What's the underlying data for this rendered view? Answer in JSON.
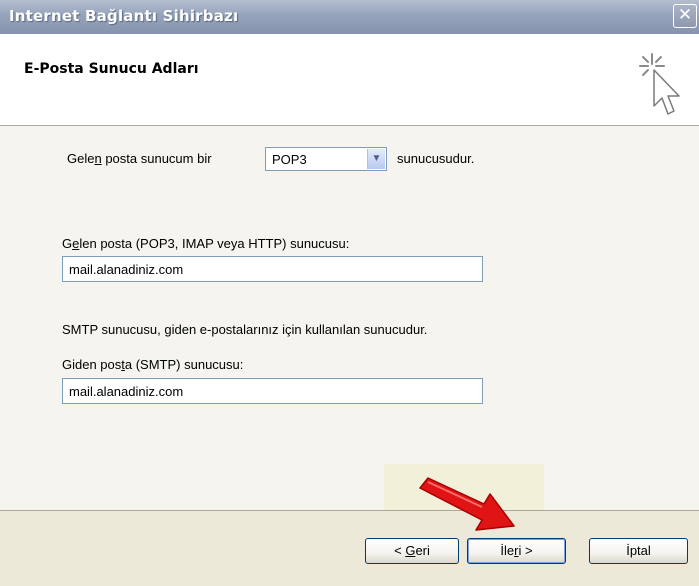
{
  "window": {
    "title": "Internet Bağlantı Sihirbazı",
    "close_label": "✕"
  },
  "header": {
    "title": "E-Posta Sunucu Adları"
  },
  "incoming_type": {
    "label_prefix": "Gele",
    "label_underlined": "n",
    "label_suffix": " posta sunucum bir",
    "selected": "POP3",
    "suffix": "sunucusudur."
  },
  "incoming_server": {
    "label_prefix": "G",
    "label_underlined": "e",
    "label_suffix": "len posta (POP3, IMAP veya HTTP) sunucusu:",
    "value": "mail.alanadiniz.com"
  },
  "smtp_info": "SMTP sunucusu, giden e-postalarınız için kullanılan sunucudur.",
  "outgoing_server": {
    "label_prefix": "Giden pos",
    "label_underlined": "t",
    "label_suffix": "a (SMTP) sunucusu:",
    "value": "mail.alanadiniz.com"
  },
  "buttons": {
    "back_prefix": "< ",
    "back_underlined": "G",
    "back_suffix": "eri",
    "next_prefix": "İle",
    "next_underlined": "r",
    "next_suffix": "i >",
    "cancel": "İptal"
  },
  "icons": {
    "wizard": "wizard-cursor-icon",
    "dropdown": "chevron-down-icon",
    "pointer": "red-arrow-icon"
  },
  "colors": {
    "pointer_arrow": "#e01414",
    "title_bar": "#95a3bb"
  }
}
